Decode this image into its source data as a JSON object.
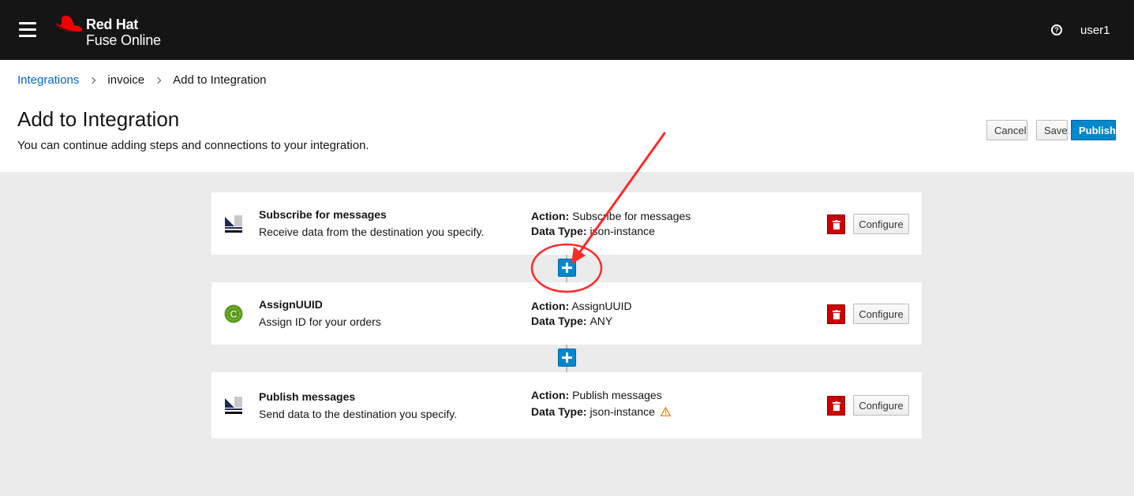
{
  "masthead": {
    "brand": "Red Hat",
    "product": "Fuse Online",
    "user": "user1",
    "menu_icon": "hamburger-menu-icon",
    "help_icon": "question-circle-icon",
    "colors": {
      "background": "#151515",
      "hat": "#ee0000"
    }
  },
  "breadcrumb": {
    "items": [
      "Integrations",
      "invoice",
      "Add to Integration"
    ]
  },
  "header": {
    "title": "Add to Integration",
    "subtitle": "You can continue adding steps and connections to your integration.",
    "cancel_label": "Cancel",
    "save_label": "Save",
    "publish_label": "Publish"
  },
  "steps": [
    {
      "name": "Subscribe for messages",
      "description": "Receive data from the destination you specify.",
      "action_label": "Action:",
      "action": "Subscribe for messages",
      "type_label": "Data Type:",
      "data_type": "json-instance",
      "icon": "amq-connector-icon",
      "warning": false
    },
    {
      "name": "AssignUUID",
      "description": "Assign ID for your orders",
      "action_label": "Action:",
      "action": "AssignUUID",
      "type_label": "Data Type:",
      "data_type": "ANY",
      "icon": "custom-extension-icon",
      "warning": false
    },
    {
      "name": "Publish messages",
      "description": "Send data to the destination you specify.",
      "action_label": "Action:",
      "action": "Publish messages",
      "type_label": "Data Type:",
      "data_type": "json-instance",
      "icon": "amq-connector-icon",
      "warning": true
    }
  ],
  "configure_label": "Configure",
  "colors": {
    "primary": "#0088ce",
    "danger": "#cc0000",
    "warning": "#ec7a08",
    "annotation": "#ff2a2a",
    "canvas": "#ebebeb"
  }
}
